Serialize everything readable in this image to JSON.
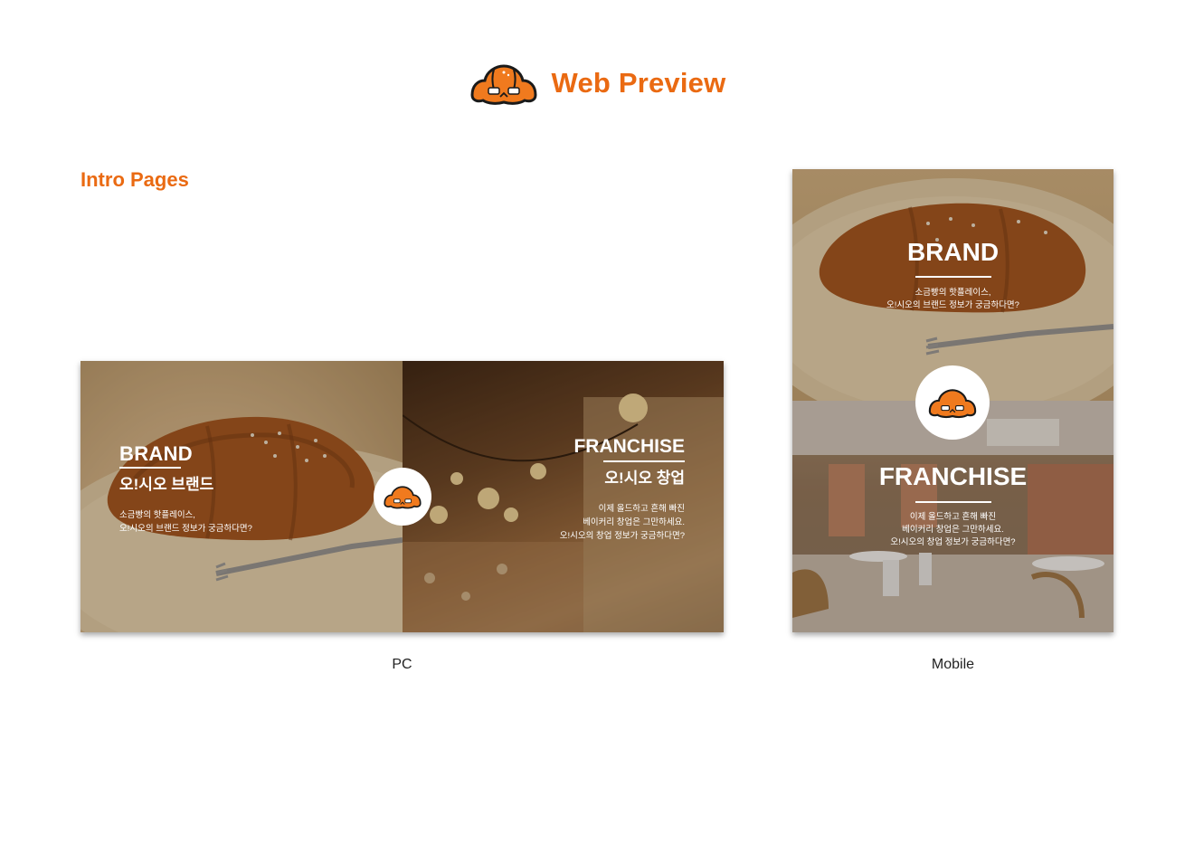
{
  "header": {
    "title": "Web Preview",
    "logo_icon": "croissant-mascot-icon"
  },
  "section": {
    "title": "Intro Pages"
  },
  "pc": {
    "caption": "PC",
    "brand": {
      "title": "BRAND",
      "subtitle": "오!시오 브랜드",
      "desc_line1": "소금빵의 핫플레이스,",
      "desc_line2": "오!시오의 브랜드 정보가 궁금하다면?"
    },
    "franchise": {
      "title": "FRANCHISE",
      "subtitle": "오!시오 창업",
      "desc_line1": "이제 올드하고 흔해 빠진",
      "desc_line2": "베이커리 창업은 그만하세요.",
      "desc_line3": "오!시오의 창업 정보가 궁금하다면?"
    }
  },
  "mobile": {
    "caption": "Mobile",
    "brand": {
      "title": "BRAND",
      "desc_line1": "소금빵의 핫플레이스,",
      "desc_line2": "오!시오의 브랜드 정보가 궁금하다면?"
    },
    "franchise": {
      "title": "FRANCHISE",
      "desc_line1": "이제 올드하고 흔해 빠진",
      "desc_line2": "베이커리 창업은 그만하세요.",
      "desc_line3": "오!시오의 창업 정보가 궁금하다면?"
    }
  },
  "colors": {
    "accent": "#ea6a12",
    "mascot_orange": "#f07a1e",
    "outline": "#1a1a1a"
  }
}
